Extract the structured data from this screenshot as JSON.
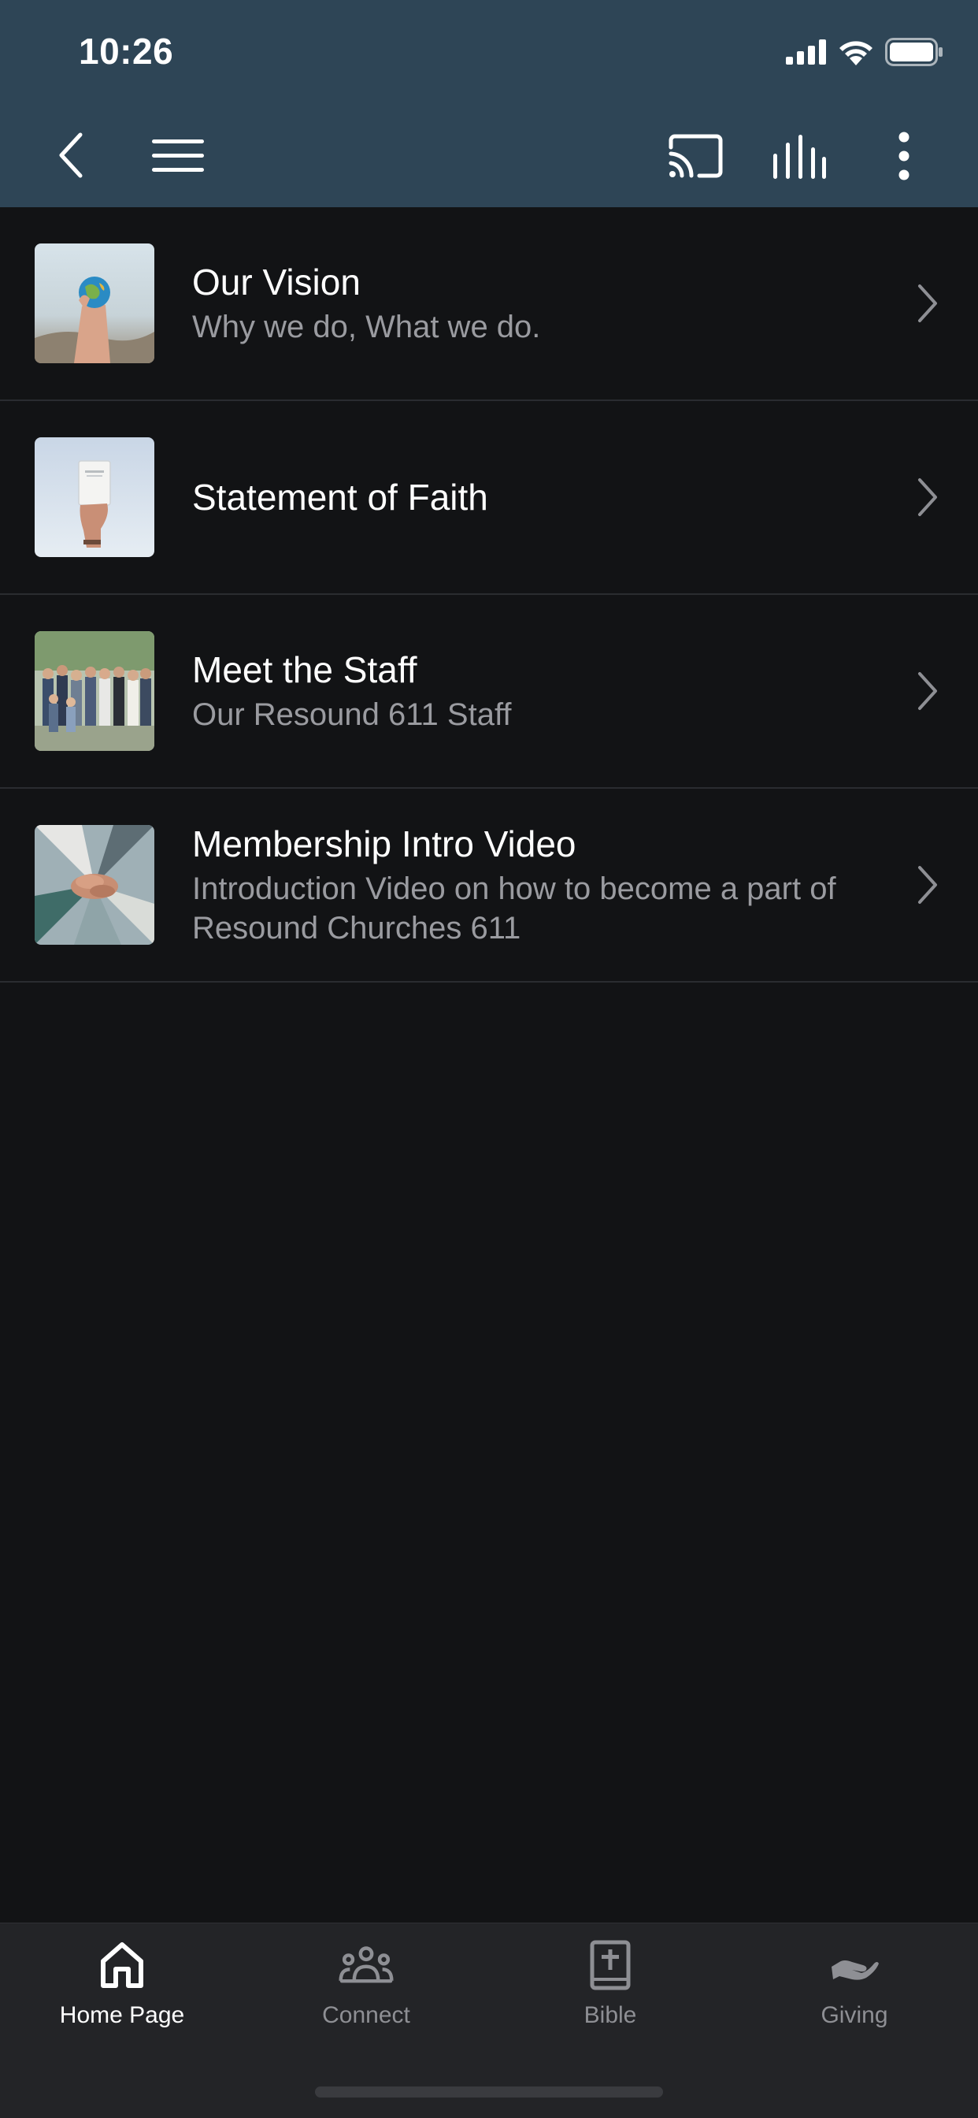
{
  "status_bar": {
    "time": "10:26"
  },
  "nav": {
    "back_icon": "chevron-left-icon",
    "menu_icon": "hamburger-icon",
    "cast_icon": "cast-icon",
    "audio_icon": "audio-bars-icon",
    "more_icon": "more-vertical-icon"
  },
  "list": {
    "items": [
      {
        "title": "Our Vision",
        "subtitle": "Why we do, What we do."
      },
      {
        "title": "Statement of Faith",
        "subtitle": ""
      },
      {
        "title": "Meet the Staff",
        "subtitle": "Our Resound 611 Staff"
      },
      {
        "title": "Membership Intro Video",
        "subtitle": "Introduction Video on how to become a part of Resound Churches 611"
      }
    ]
  },
  "tabbar": {
    "tabs": [
      {
        "label": "Home Page",
        "icon": "home-icon",
        "active": true
      },
      {
        "label": "Connect",
        "icon": "people-group-icon",
        "active": false
      },
      {
        "label": "Bible",
        "icon": "bible-icon",
        "active": false
      },
      {
        "label": "Giving",
        "icon": "giving-hand-icon",
        "active": false
      }
    ]
  },
  "colors": {
    "header_bg": "#2e4556",
    "page_bg": "#121315",
    "tabbar_bg": "#232427",
    "subtitle": "#9a9ba0",
    "divider": "#2a2c30"
  }
}
